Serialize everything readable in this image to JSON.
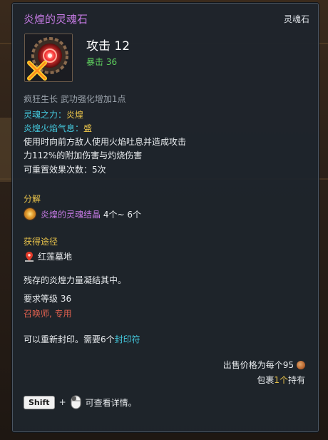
{
  "item": {
    "name": "炎煌的灵魂石",
    "type": "灵魂石",
    "main_stat": "攻击 12",
    "sub_stat": "暴击 36",
    "growth_desc": "疯狂生长 武功强化增加1点"
  },
  "effects": {
    "soul_power_label": "灵魂之力：",
    "soul_power_value": "炎煌",
    "flame_label": "炎煌火焰气息：",
    "flame_value": "盛",
    "desc_line1": "使用时向前方敌人使用火焰吐息并造成攻击",
    "desc_line2": "力112%的附加伤害与灼烧伤害",
    "reset_line": "可重置效果次数：5次"
  },
  "decompose": {
    "header": "分解",
    "item_name": "炎煌的灵魂结晶",
    "quantity": " 4个~ 6个"
  },
  "acquire": {
    "header": "获得途径",
    "location": "红莲墓地"
  },
  "flavor_text": "残存的炎煌力量凝结其中。",
  "requirements": {
    "level": "要求等级 36",
    "class": "召唤师, 专用"
  },
  "reseal": {
    "text": "可以重新封印。需要6个",
    "link": "封印符"
  },
  "price": {
    "text": "出售价格为每个95"
  },
  "inventory": {
    "prefix": "包裹",
    "count": "1个",
    "suffix": "持有"
  },
  "footer": {
    "shift_key": "Shift",
    "plus": "+",
    "hint": "可查看详情。"
  },
  "colors": {
    "title": "#c77be6",
    "cyan": "#44c8dd",
    "yellow": "#e8c24a",
    "green": "#5fd15f",
    "red": "#e0614f"
  },
  "icons": {
    "item": "soul-stone-icon",
    "crystal": "soul-crystal-icon",
    "location": "location-pin-icon",
    "coin": "copper-coin-icon",
    "mouse": "mouse-icon"
  }
}
